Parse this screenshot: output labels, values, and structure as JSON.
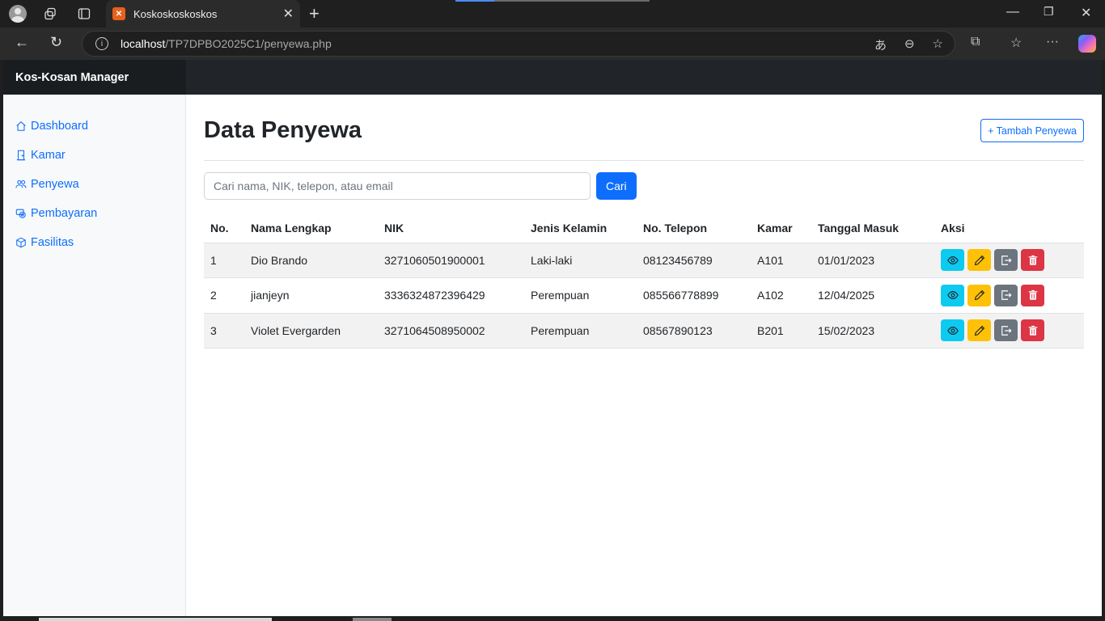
{
  "browser": {
    "tab_title": "Koskoskoskoskos",
    "url_host": "localhost",
    "url_path": "/TP7DPBO2025C1/penyewa.php"
  },
  "app": {
    "brand": "Kos-Kosan Manager"
  },
  "sidebar": {
    "items": [
      {
        "label": "Dashboard",
        "icon": "house-icon"
      },
      {
        "label": "Kamar",
        "icon": "door-icon"
      },
      {
        "label": "Penyewa",
        "icon": "people-icon"
      },
      {
        "label": "Pembayaran",
        "icon": "cash-icon"
      },
      {
        "label": "Fasilitas",
        "icon": "box-icon"
      }
    ]
  },
  "main": {
    "title": "Data Penyewa",
    "add_button": "+ Tambah Penyewa",
    "search": {
      "placeholder": "Cari nama, NIK, telepon, atau email",
      "value": "",
      "button": "Cari"
    },
    "table": {
      "headers": [
        "No.",
        "Nama Lengkap",
        "NIK",
        "Jenis Kelamin",
        "No. Telepon",
        "Kamar",
        "Tanggal Masuk",
        "Aksi"
      ],
      "rows": [
        [
          "1",
          "Dio Brando",
          "3271060501900001",
          "Laki-laki",
          "08123456789",
          "A101",
          "01/01/2023"
        ],
        [
          "2",
          "jianjeyn",
          "3336324872396429",
          "Perempuan",
          "085566778899",
          "A102",
          "12/04/2025"
        ],
        [
          "3",
          "Violet Evergarden",
          "3271064508950002",
          "Perempuan",
          "08567890123",
          "B201",
          "15/02/2023"
        ]
      ]
    }
  },
  "colors": {
    "primary": "#0d6efd",
    "info": "#0dcaf0",
    "warning": "#ffc107",
    "secondary": "#6c757d",
    "danger": "#dc3545"
  }
}
